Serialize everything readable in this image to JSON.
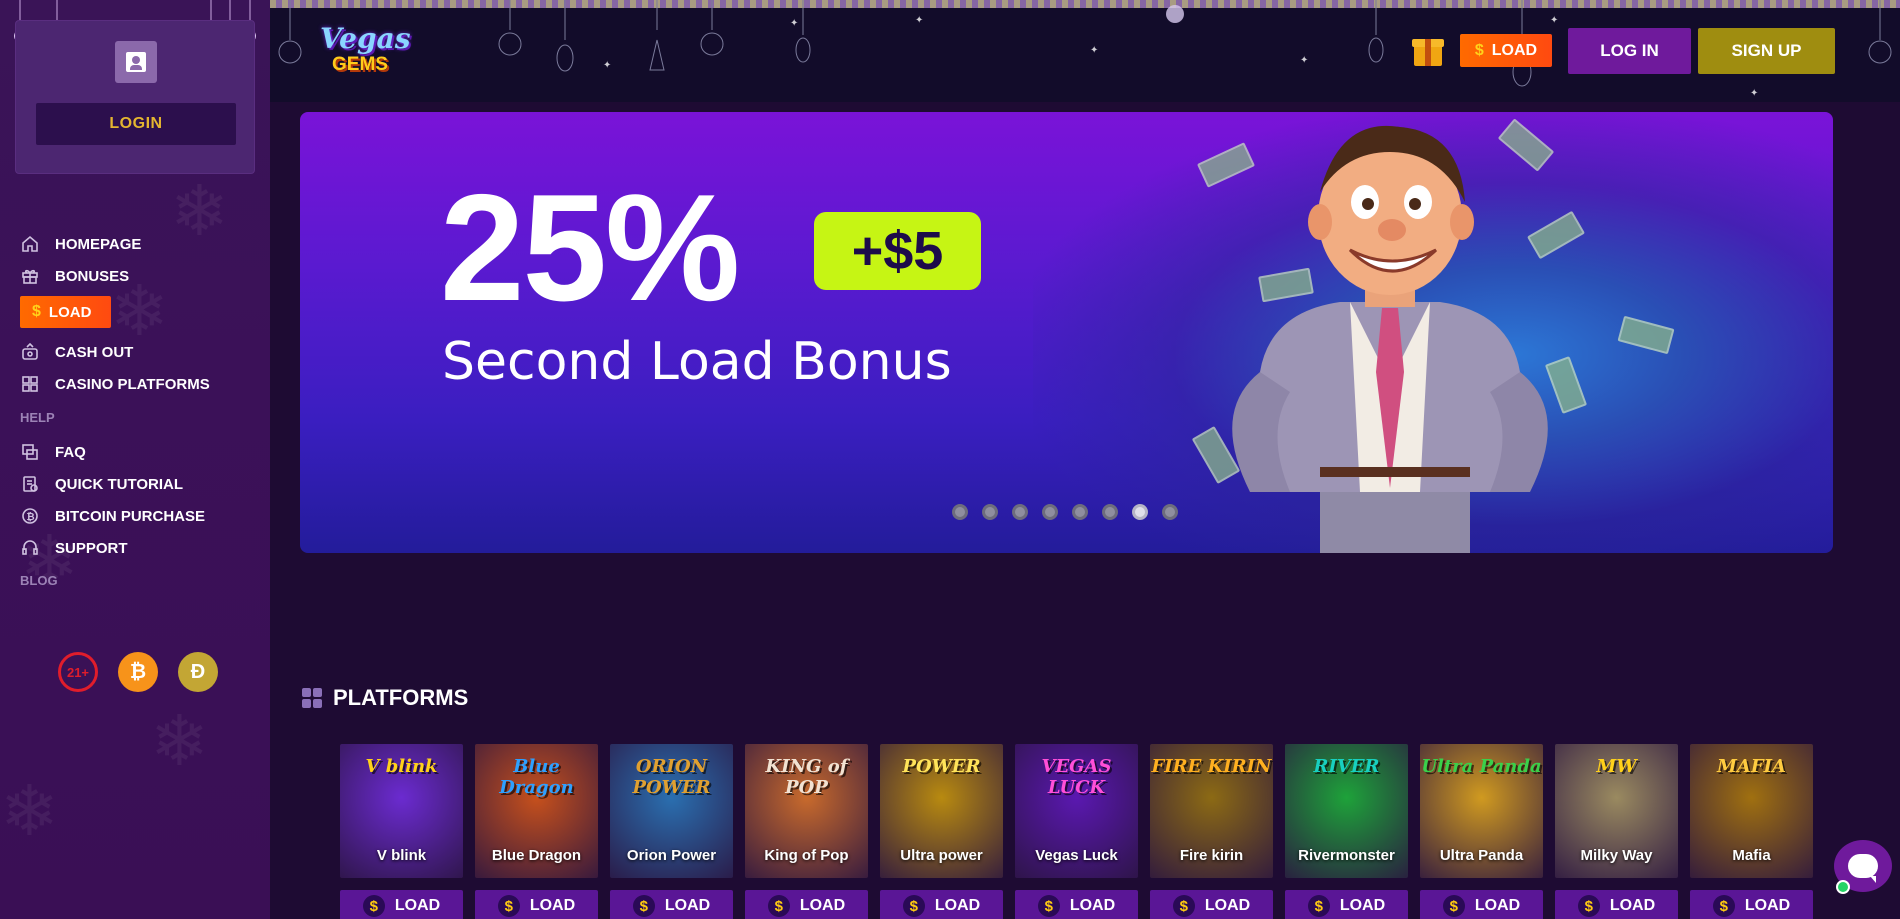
{
  "sidebar": {
    "login_label": "LOGIN",
    "nav": [
      {
        "label": "HOMEPAGE",
        "icon": "home-icon"
      },
      {
        "label": "BONUSES",
        "icon": "gift-icon"
      }
    ],
    "load_label": "LOAD",
    "nav2": [
      {
        "label": "CASH OUT",
        "icon": "cash-out-icon"
      },
      {
        "label": "CASINO PLATFORMS",
        "icon": "grid-icon"
      }
    ],
    "help_title": "HELP",
    "help_items": [
      {
        "label": "FAQ",
        "icon": "faq-icon"
      },
      {
        "label": "QUICK TUTORIAL",
        "icon": "tutorial-icon"
      },
      {
        "label": "BITCOIN PURCHASE",
        "icon": "bitcoin-icon"
      },
      {
        "label": "SUPPORT",
        "icon": "headset-icon"
      }
    ],
    "blog_title": "BLOG",
    "badges": {
      "age": "21+",
      "btc": "₿",
      "doge": "Ð"
    }
  },
  "header": {
    "logo_line1": "Vegas",
    "logo_line2": "GEMS",
    "load_label": "LOAD",
    "login_label": "LOG IN",
    "signup_label": "SIGN UP"
  },
  "banner": {
    "headline": "25%",
    "bonus_tag": "+$5",
    "subtitle": "Second Load Bonus",
    "slide_count": 8,
    "active_slide": 7
  },
  "platforms": {
    "title": "PLATFORMS",
    "load_label": "LOAD",
    "coin_symbol": "$",
    "items": [
      {
        "name": "V blink",
        "art": "V blink",
        "bg": "#6b2bd0",
        "art_color": "#ffd11a"
      },
      {
        "name": "Blue Dragon",
        "art": "Blue Dragon",
        "bg": "#c6501c",
        "art_color": "#2ea0ff"
      },
      {
        "name": "Orion Power",
        "art": "ORION POWER",
        "bg": "#2a6fb0",
        "art_color": "#e0a030"
      },
      {
        "name": "King of Pop",
        "art": "KING of POP",
        "bg": "#c86a2c",
        "art_color": "#f2e2d2"
      },
      {
        "name": "Ultra power",
        "art": "POWER",
        "bg": "#b88a10",
        "art_color": "#ffe45a"
      },
      {
        "name": "Vegas Luck",
        "art": "VEGAS LUCK",
        "bg": "#5a18b0",
        "art_color": "#ff4fd8"
      },
      {
        "name": "Fire kirin",
        "art": "FIRE KIRIN",
        "bg": "#8c6a14",
        "art_color": "#ffb020"
      },
      {
        "name": "Rivermonster",
        "art": "RIVER",
        "bg": "#1ea23a",
        "art_color": "#18d0c0"
      },
      {
        "name": "Ultra Panda",
        "art": "Ultra Panda",
        "bg": "#d09a20",
        "art_color": "#3ad04a"
      },
      {
        "name": "Milky Way",
        "art": "MW",
        "bg": "#9a8a60",
        "art_color": "#ffd11a"
      },
      {
        "name": "Mafia",
        "art": "MAFIA",
        "bg": "#a07010",
        "art_color": "#ffcc40"
      }
    ]
  }
}
